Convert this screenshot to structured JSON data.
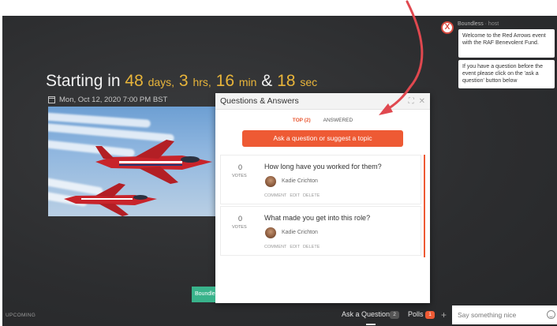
{
  "countdown": {
    "prefix": "Starting in",
    "days_value": "48",
    "days_unit": "days,",
    "hours_value": "3",
    "hours_unit": "hrs,",
    "minutes_value": "16",
    "minutes_unit": "min",
    "ampersand": "&",
    "seconds_value": "18",
    "seconds_unit": "sec"
  },
  "event": {
    "date": "Mon, Oct 12, 2020 7:00 PM BST"
  },
  "chat": {
    "host_name": "Boundless",
    "host_role": "· host",
    "messages": [
      "Welcome to the Red Arrows event with the RAF Benevolent Fund.",
      "If you have a question before the event please click on the 'ask a question' button below"
    ],
    "input_placeholder": "Say something nice"
  },
  "qa": {
    "title": "Questions & Answers",
    "tabs": {
      "top": "TOP (2)",
      "answered": "ANSWERED"
    },
    "ask_button": "Ask a question or suggest a topic",
    "questions": [
      {
        "votes": "0",
        "votes_label": "VOTES",
        "text": "How long have you worked for them?",
        "author": "Kadie Crichton",
        "actions": [
          "COMMENT",
          "EDIT",
          "DELETE"
        ]
      },
      {
        "votes": "0",
        "votes_label": "VOTES",
        "text": "What made you get into this role?",
        "author": "Kadie Crichton",
        "actions": [
          "COMMENT",
          "EDIT",
          "DELETE"
        ]
      }
    ]
  },
  "bottom_bar": {
    "status": "UPCOMING",
    "ask_question_label": "Ask a Question",
    "ask_question_count": "2",
    "polls_label": "Polls",
    "polls_count": "1"
  },
  "side_button": "Boundless",
  "colors": {
    "accent": "#ee5a34",
    "countdown_highlight": "#e9b53a",
    "stage_bg": "#2e2f31",
    "annotation_arrow": "#e0484f"
  },
  "icons": [
    "calendar-icon",
    "expand-icon",
    "close-icon",
    "plus-icon",
    "smile-icon",
    "host-logo-icon",
    "user-avatar"
  ]
}
